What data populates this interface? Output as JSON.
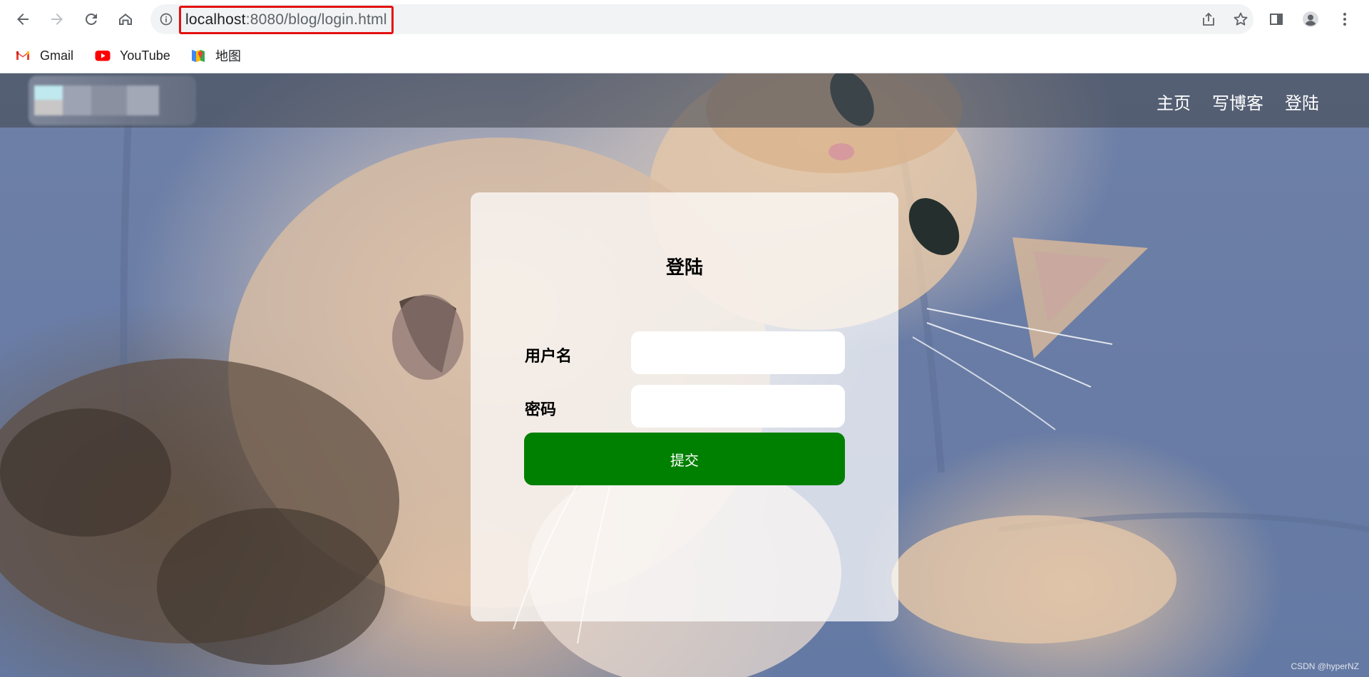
{
  "browser": {
    "url_host": "localhost",
    "url_rest": ":8080/blog/login.html",
    "bookmarks": [
      {
        "label": "Gmail",
        "icon": "gmail-icon"
      },
      {
        "label": "YouTube",
        "icon": "youtube-icon"
      },
      {
        "label": "地图",
        "icon": "maps-icon"
      }
    ]
  },
  "header": {
    "nav": [
      "主页",
      "写博客",
      "登陆"
    ]
  },
  "login": {
    "title": "登陆",
    "username_label": "用户名",
    "password_label": "密码",
    "submit_label": "提交"
  },
  "watermark": "CSDN @hyperNZ",
  "colors": {
    "submit": "#008000",
    "url_highlight": "#e3110f"
  }
}
